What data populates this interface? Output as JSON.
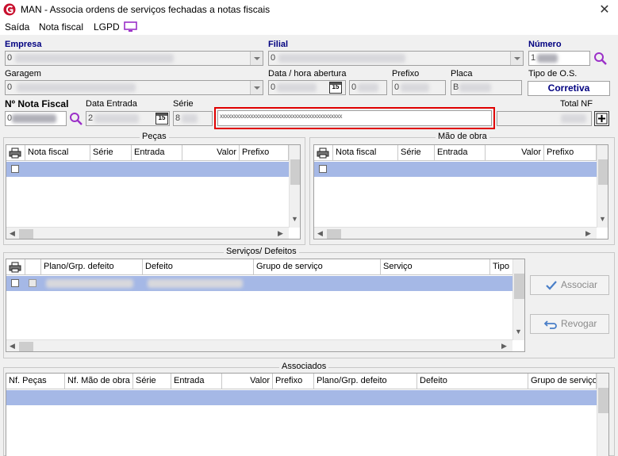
{
  "window": {
    "title": "MAN - Associa ordens de serviços fechadas a notas fiscais",
    "close_label": "✕"
  },
  "menu": {
    "items": [
      {
        "label": "Saída"
      },
      {
        "label": "Nota fiscal"
      },
      {
        "label": "LGPD"
      }
    ]
  },
  "header": {
    "empresa_label": "Empresa",
    "empresa_value": "0",
    "filial_label": "Filial",
    "filial_value": "0",
    "numero_label": "Número",
    "numero_value": "1",
    "garagem_label": "Garagem",
    "garagem_value": "0",
    "data_abertura_label": "Data / hora abertura",
    "data_abertura_value": "0",
    "hora_abertura_value": "0",
    "prefixo_label": "Prefixo",
    "prefixo_value": "0",
    "placa_label": "Placa",
    "placa_value": "B",
    "tipo_os_label": "Tipo de O.S.",
    "tipo_os_value": "Corretiva",
    "nota_fiscal_label": "Nº Nota Fiscal",
    "nota_fiscal_value": "0",
    "data_entrada_label": "Data Entrada",
    "data_entrada_value": "2",
    "serie_label": "Série",
    "serie_value": "8",
    "observacao_value": "xxxxxxxxxxxxxxxxxxxxxxxxxxxxxxxxxxxxxxxxxxxx",
    "total_nf_label": "Total NF",
    "calendar_glyph": "15"
  },
  "pecas": {
    "title": "Peças",
    "columns": [
      "Nota fiscal",
      "Série",
      "Entrada",
      "Valor",
      "Prefixo"
    ]
  },
  "mao_obra": {
    "title": "Mão de obra",
    "columns": [
      "Nota fiscal",
      "Série",
      "Entrada",
      "Valor",
      "Prefixo"
    ]
  },
  "servicos": {
    "title": "Serviços/ Defeitos",
    "columns": [
      "Plano/Grp. defeito",
      "Defeito",
      "Grupo de serviço",
      "Serviço",
      "Tipo"
    ],
    "associar_label": "Associar",
    "revogar_label": "Revogar"
  },
  "associados": {
    "title": "Associados",
    "columns": [
      "Nf. Peças",
      "Nf. Mão de obra",
      "Série",
      "Entrada",
      "Valor",
      "Prefixo",
      "Plano/Grp. defeito",
      "Defeito",
      "Grupo de serviço"
    ]
  },
  "colors": {
    "selection": "#a5b8e6",
    "label_blue": "#000080",
    "highlight_red": "#e00000",
    "logo_red": "#c8102e"
  }
}
